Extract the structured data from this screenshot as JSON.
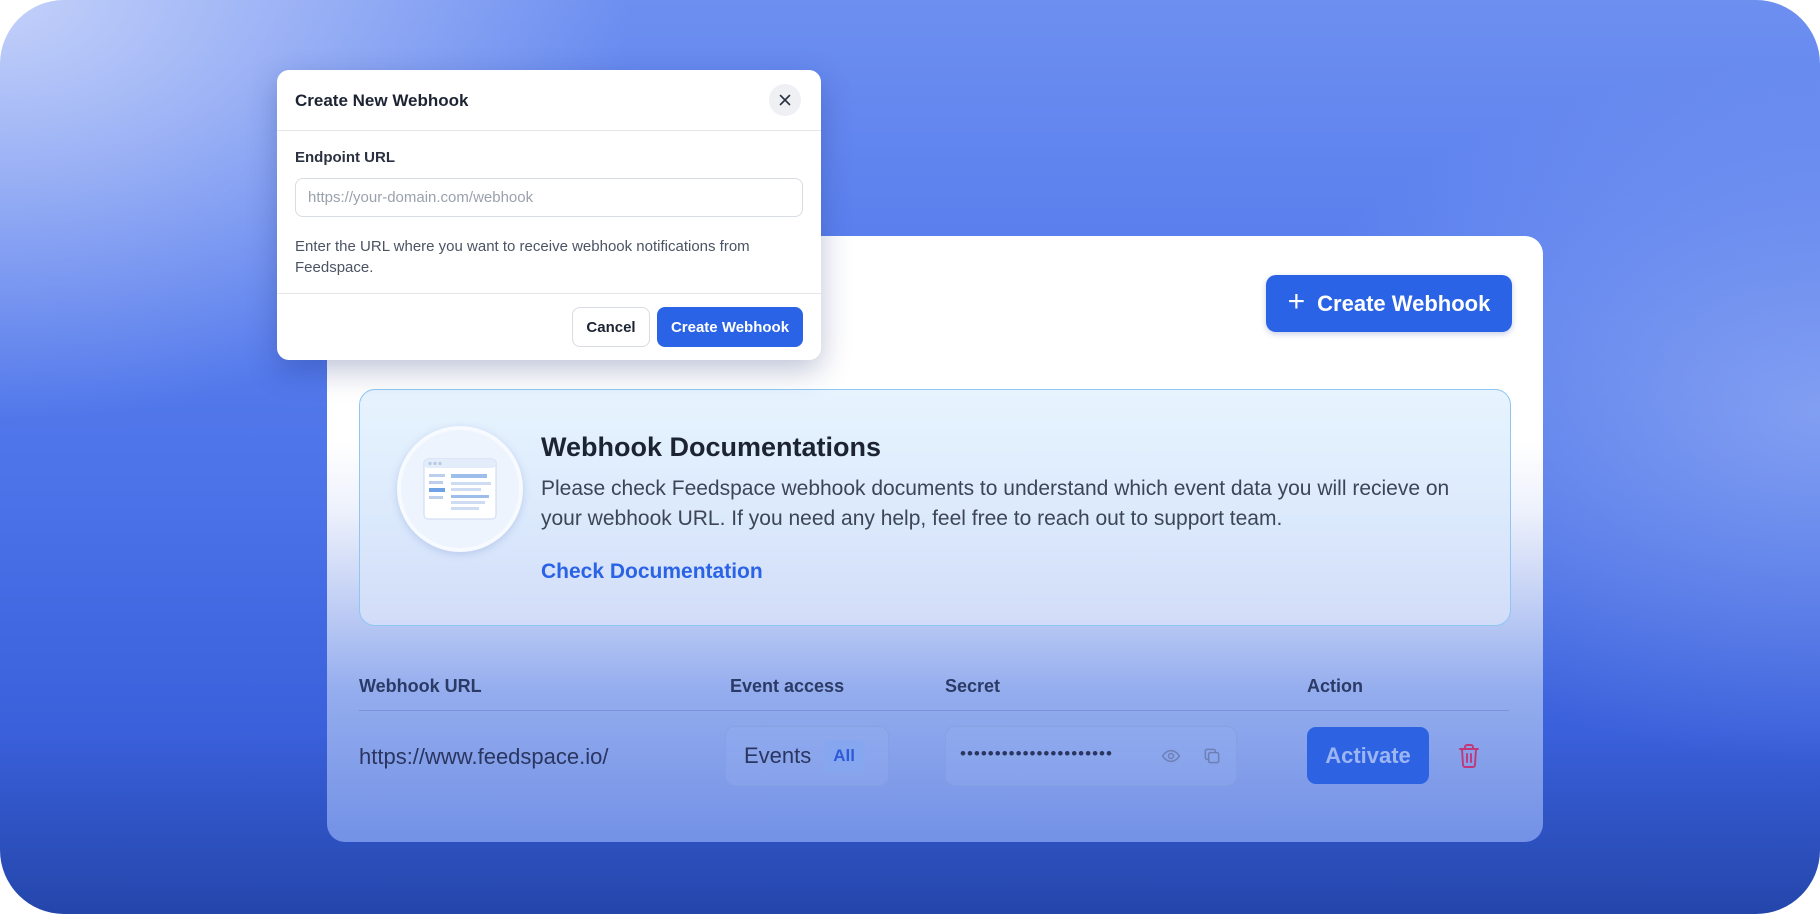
{
  "page": {
    "create_button_label": "Create Webhook"
  },
  "docs": {
    "title": "Webhook Documentations",
    "body": "Please check Feedspace webhook documents to understand which event data you will recieve on your webhook URL. If you need any help, feel free to reach out to support team.",
    "link_label": "Check Documentation"
  },
  "table": {
    "columns": [
      "Webhook URL",
      "Event access",
      "Secret",
      "Action"
    ],
    "rows": [
      {
        "url": "https://www.feedspace.io/",
        "events_label": "Events",
        "events_badge": "All",
        "secret_masked": "••••••••••••••••••••••",
        "action_label": "Activate"
      }
    ]
  },
  "modal": {
    "title": "Create New Webhook",
    "field_label": "Endpoint URL",
    "field_placeholder": "https://your-domain.com/webhook",
    "field_value": "",
    "help_text": "Enter the URL where you want to receive webhook notifications from Feedspace.",
    "cancel_label": "Cancel",
    "submit_label": "Create Webhook"
  },
  "colors": {
    "primary": "#2b63e6",
    "danger_icon": "#c0387a",
    "doc_border": "#8ec6f4"
  },
  "icons": [
    "plus-icon",
    "close-icon",
    "eye-icon",
    "copy-icon",
    "trash-icon",
    "documentation-illustration"
  ]
}
